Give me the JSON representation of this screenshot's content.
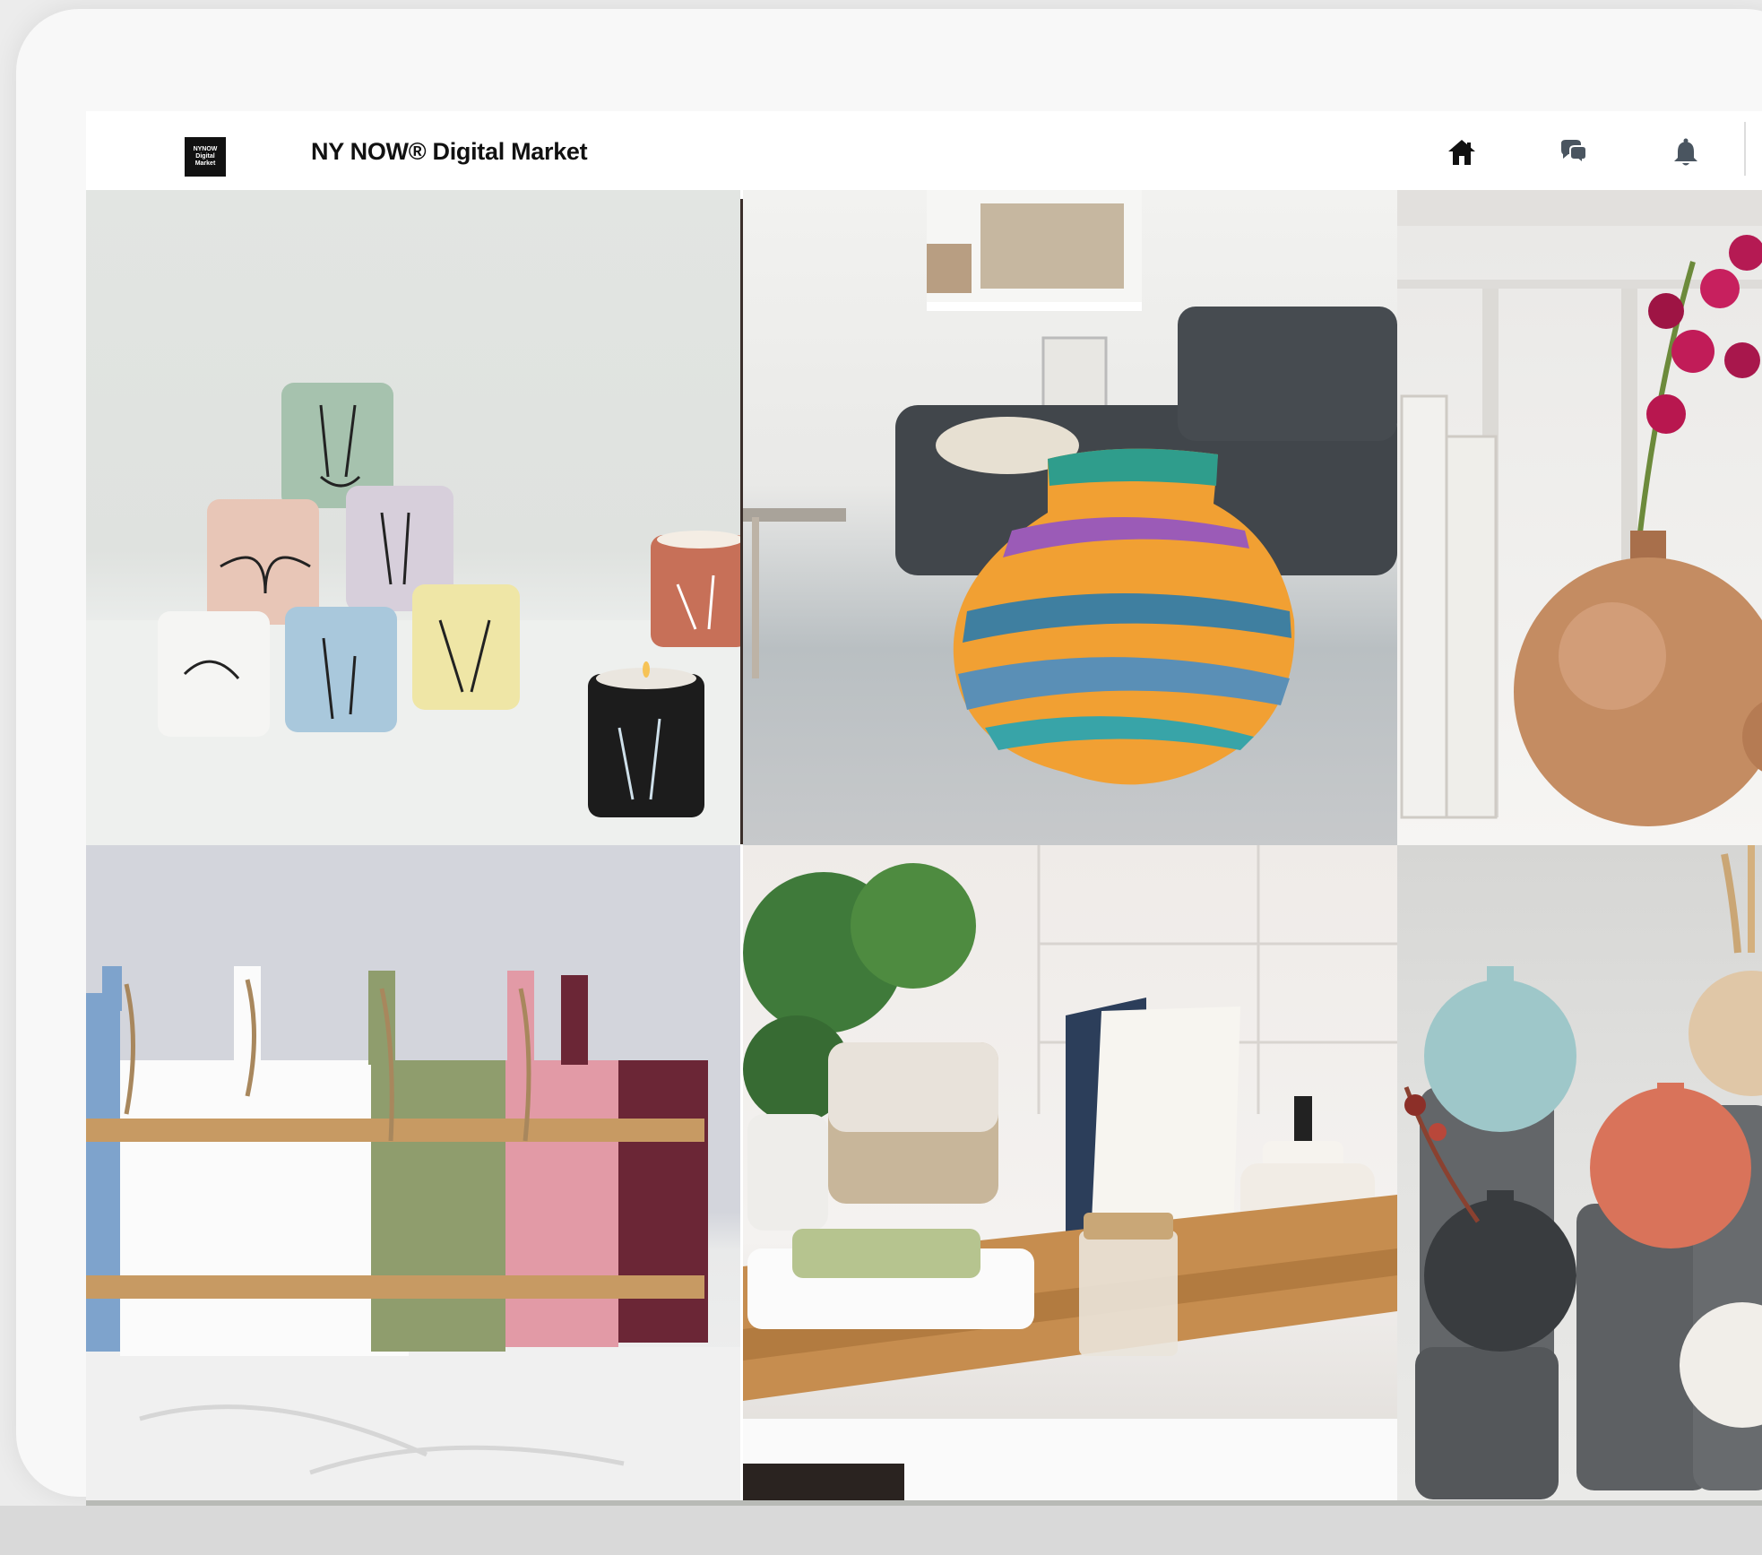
{
  "app": {
    "title": "NY NOW® Digital Market",
    "logo_lines": [
      "NYNOW",
      "Digital",
      "Market"
    ]
  },
  "nav": {
    "home_icon": "home-icon",
    "chat_icon": "chat-bubbles-icon",
    "bell_icon": "bell-icon"
  },
  "tiles": [
    {
      "subject": "candles",
      "bg": "#e3e6e4"
    },
    {
      "subject": "woven-basket",
      "bg": "#ededeb"
    },
    {
      "subject": "copper-vases-orchid",
      "bg": "#f1f0ee"
    },
    {
      "subject": "cutting-boards",
      "bg": "#d3d5dc"
    },
    {
      "subject": "bath-tray",
      "bg": "#e7e3df"
    },
    {
      "subject": "ceramic-vases",
      "bg": "#d9d9d7"
    }
  ],
  "colors": {
    "accent_dark": "#111111",
    "frame": "#f8f8f8"
  }
}
